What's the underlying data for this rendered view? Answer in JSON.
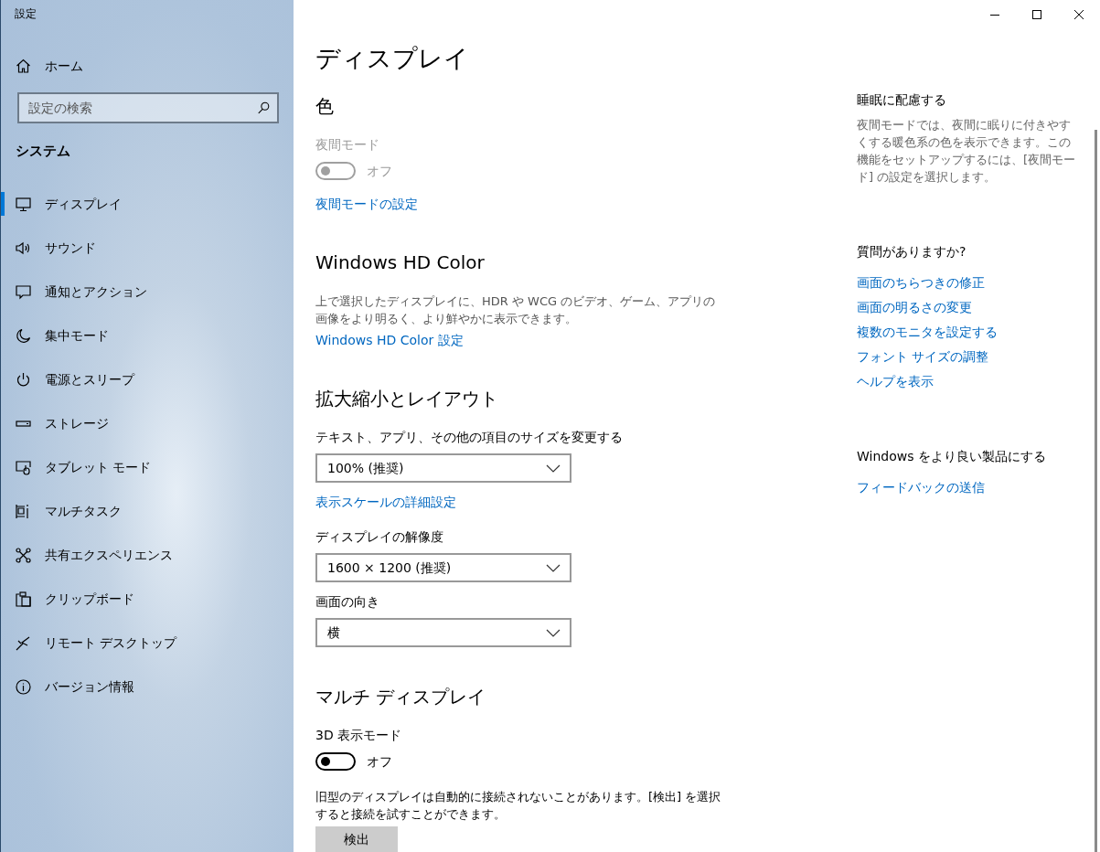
{
  "window": {
    "title": "設定"
  },
  "sidebar": {
    "home": "ホーム",
    "search": {
      "placeholder": "設定の検索"
    },
    "section": "システム",
    "items": [
      {
        "label": "ディスプレイ",
        "selected": true
      },
      {
        "label": "サウンド",
        "selected": false
      },
      {
        "label": "通知とアクション",
        "selected": false
      },
      {
        "label": "集中モード",
        "selected": false
      },
      {
        "label": "電源とスリープ",
        "selected": false
      },
      {
        "label": "ストレージ",
        "selected": false
      },
      {
        "label": "タブレット モード",
        "selected": false
      },
      {
        "label": "マルチタスク",
        "selected": false
      },
      {
        "label": "共有エクスペリエンス",
        "selected": false
      },
      {
        "label": "クリップボード",
        "selected": false
      },
      {
        "label": "リモート デスクトップ",
        "selected": false
      },
      {
        "label": "バージョン情報",
        "selected": false
      }
    ]
  },
  "main": {
    "title": "ディスプレイ",
    "sections": [
      {
        "heading": "色",
        "items": [
          {
            "kind": "label",
            "text": "夜間モード",
            "disabled": true
          },
          {
            "kind": "toggle",
            "state_text": "オフ",
            "on": false,
            "disabled": true
          },
          {
            "kind": "link",
            "text": "夜間モードの設定"
          }
        ]
      },
      {
        "heading": "Windows HD Color",
        "items": [
          {
            "kind": "text",
            "text": "上で選択したディスプレイに、HDR や WCG のビデオ、ゲーム、アプリの画像をより明るく、より鮮やかに表示できます。"
          },
          {
            "kind": "link",
            "text": "Windows HD Color 設定"
          }
        ]
      },
      {
        "heading": "拡大縮小とレイアウト",
        "items": [
          {
            "kind": "label",
            "text": "テキスト、アプリ、その他の項目のサイズを変更する",
            "disabled": false
          },
          {
            "kind": "dropdown",
            "value": "100% (推奨)"
          },
          {
            "kind": "link",
            "text": "表示スケールの詳細設定"
          },
          {
            "kind": "label",
            "text": "ディスプレイの解像度",
            "disabled": false
          },
          {
            "kind": "dropdown",
            "value": "1600 × 1200 (推奨)"
          },
          {
            "kind": "label",
            "text": "画面の向き",
            "disabled": false
          },
          {
            "kind": "dropdown",
            "value": "横"
          }
        ]
      },
      {
        "heading": "マルチ ディスプレイ",
        "items": [
          {
            "kind": "label",
            "text": "3D 表示モード",
            "disabled": false
          },
          {
            "kind": "toggle",
            "state_text": "オフ",
            "on": false,
            "disabled": false
          },
          {
            "kind": "text",
            "text": "旧型のディスプレイは自動的に接続されないことがあります。[検出] を選択すると接続を試すことができます。"
          },
          {
            "kind": "button",
            "text": "検出"
          }
        ]
      }
    ]
  },
  "side_panel": {
    "sections": [
      {
        "heading": "睡眠に配慮する",
        "text": "夜間モードでは、夜間に眠りに付きやすくする暖色系の色を表示できます。この機能をセットアップするには、[夜間モード] の設定を選択します。"
      },
      {
        "heading": "質問がありますか?",
        "links": [
          "画面のちらつきの修正",
          "画面の明るさの変更",
          "複数のモニタを設定する",
          "フォント サイズの調整",
          "ヘルプを表示"
        ]
      },
      {
        "heading": "Windows をより良い製品にする",
        "links": [
          "フィードバックの送信"
        ]
      }
    ]
  }
}
